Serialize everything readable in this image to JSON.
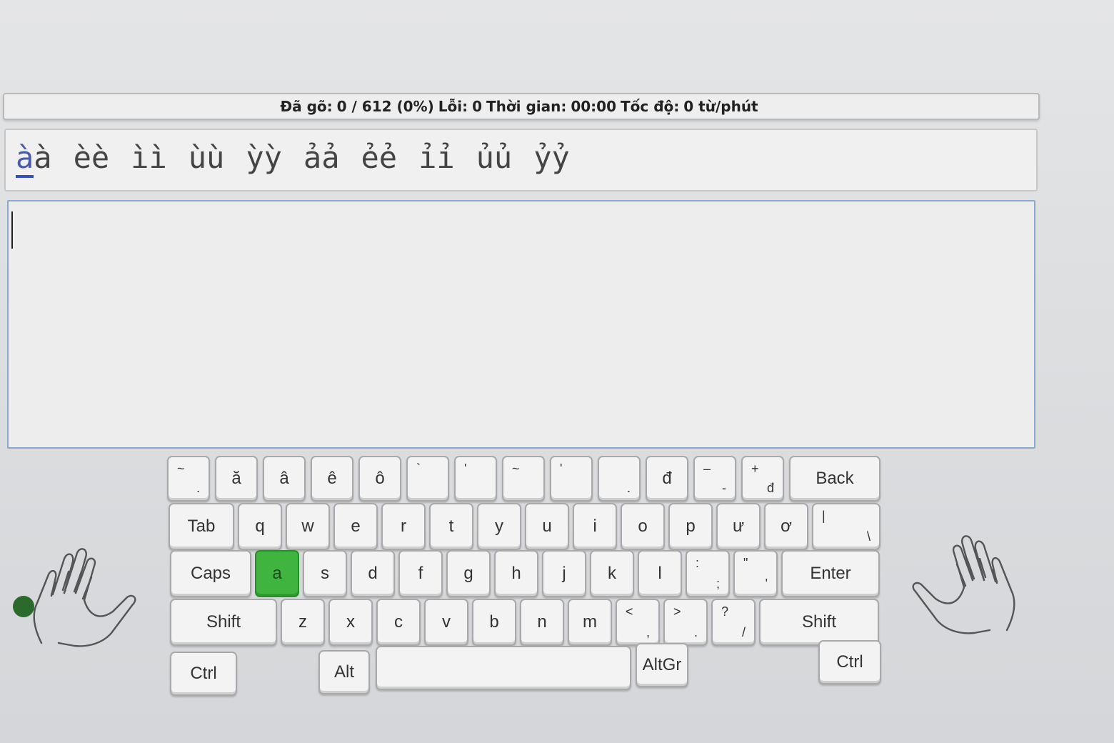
{
  "stats": {
    "typed_label": "Đã gõ:",
    "typed_value": "0 / 612 (0%)",
    "errors_label": "Lỗi:",
    "errors_value": "0",
    "time_label": "Thời gian:",
    "time_value": "00:00",
    "speed_label": "Tốc độ:",
    "speed_value": "0 từ/phút"
  },
  "prompt": {
    "current_char": "à",
    "words": [
      "àà",
      "èè",
      "ìì",
      "ùù",
      "ỳỳ",
      "ảả",
      "ẻẻ",
      "ỉỉ",
      "ủủ",
      "ỷỷ"
    ]
  },
  "input": {
    "value": ""
  },
  "keyboard": {
    "row1": [
      {
        "top": "~",
        "bot": "."
      },
      {
        "label": "ă"
      },
      {
        "label": "â"
      },
      {
        "label": "ê"
      },
      {
        "label": "ô"
      },
      {
        "top": "`"
      },
      {
        "top": "'"
      },
      {
        "top": "~"
      },
      {
        "top": "'"
      },
      {
        "bot": "."
      },
      {
        "label": "đ"
      },
      {
        "top": "–",
        "bot": "-"
      },
      {
        "top": "+",
        "bot": "đ"
      },
      {
        "label": "Back"
      }
    ],
    "row2": [
      {
        "label": "Tab"
      },
      {
        "label": "q"
      },
      {
        "label": "w"
      },
      {
        "label": "e"
      },
      {
        "label": "r"
      },
      {
        "label": "t"
      },
      {
        "label": "y"
      },
      {
        "label": "u"
      },
      {
        "label": "i"
      },
      {
        "label": "o"
      },
      {
        "label": "p"
      },
      {
        "label": "ư"
      },
      {
        "label": "ơ"
      },
      {
        "top": "|",
        "bot": "\\"
      }
    ],
    "row3": [
      {
        "label": "Caps"
      },
      {
        "label": "a"
      },
      {
        "label": "s"
      },
      {
        "label": "d"
      },
      {
        "label": "f"
      },
      {
        "label": "g"
      },
      {
        "label": "h"
      },
      {
        "label": "j"
      },
      {
        "label": "k"
      },
      {
        "label": "l"
      },
      {
        "top": ":",
        "bot": ";"
      },
      {
        "top": "\"",
        "bot": "'"
      },
      {
        "label": "Enter"
      }
    ],
    "row4": [
      {
        "label": "Shift"
      },
      {
        "label": "z"
      },
      {
        "label": "x"
      },
      {
        "label": "c"
      },
      {
        "label": "v"
      },
      {
        "label": "b"
      },
      {
        "label": "n"
      },
      {
        "label": "m"
      },
      {
        "top": "<",
        "bot": ","
      },
      {
        "top": ">",
        "bot": "."
      },
      {
        "top": "?",
        "bot": "/"
      },
      {
        "label": "Shift"
      }
    ],
    "row5": [
      {
        "label": "Ctrl"
      },
      {
        "label": "Alt"
      },
      {
        "label": ""
      },
      {
        "label": "AltGr"
      },
      {
        "label": "Ctrl"
      }
    ],
    "active_key": "a",
    "active_color": "#3fb43f",
    "finger_dot_color": "#2b6a2b"
  }
}
